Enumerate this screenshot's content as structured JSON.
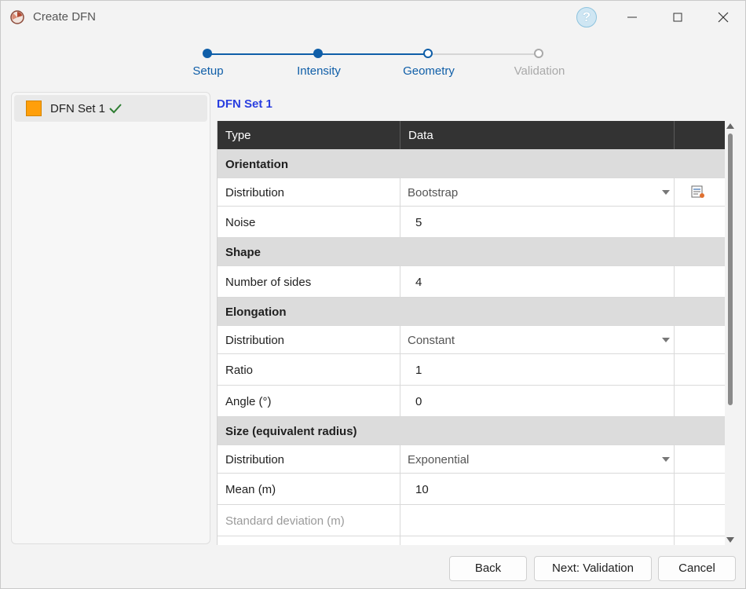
{
  "window": {
    "title": "Create DFN",
    "help_glyph": "?"
  },
  "stepper": {
    "steps": [
      {
        "label": "Setup",
        "state": "done"
      },
      {
        "label": "Intensity",
        "state": "done"
      },
      {
        "label": "Geometry",
        "state": "current"
      },
      {
        "label": "Validation",
        "state": "pending"
      }
    ],
    "colors": {
      "active": "#0f5ea8",
      "pending": "#a9a9a9"
    }
  },
  "sets": [
    {
      "label": "DFN Set 1",
      "swatch_color": "#ff9f0a",
      "status_icon": "checkmark-icon"
    }
  ],
  "panel": {
    "title": "DFN Set 1"
  },
  "grid": {
    "columns": [
      "Type",
      "Data",
      ""
    ],
    "rows": [
      {
        "kind": "section",
        "label": "Orientation"
      },
      {
        "kind": "combo",
        "label": "Distribution",
        "value": "Bootstrap",
        "action_icon": "edit-table-icon"
      },
      {
        "kind": "value",
        "label": "Noise",
        "value": "5"
      },
      {
        "kind": "section",
        "label": "Shape"
      },
      {
        "kind": "value",
        "label": "Number of sides",
        "value": "4"
      },
      {
        "kind": "section",
        "label": "Elongation"
      },
      {
        "kind": "combo",
        "label": "Distribution",
        "value": "Constant"
      },
      {
        "kind": "value",
        "label": "Ratio",
        "value": "1"
      },
      {
        "kind": "value",
        "label": "Angle (°)",
        "value": "0"
      },
      {
        "kind": "section",
        "label": "Size (equivalent radius)"
      },
      {
        "kind": "combo",
        "label": "Distribution",
        "value": "Exponential"
      },
      {
        "kind": "value",
        "label": "Mean (m)",
        "value": "10"
      },
      {
        "kind": "disabled",
        "label": "Standard deviation (m)",
        "value": ""
      },
      {
        "kind": "value",
        "label": "",
        "value": ""
      }
    ]
  },
  "buttons": {
    "back": "Back",
    "next": "Next: Validation",
    "cancel": "Cancel"
  }
}
